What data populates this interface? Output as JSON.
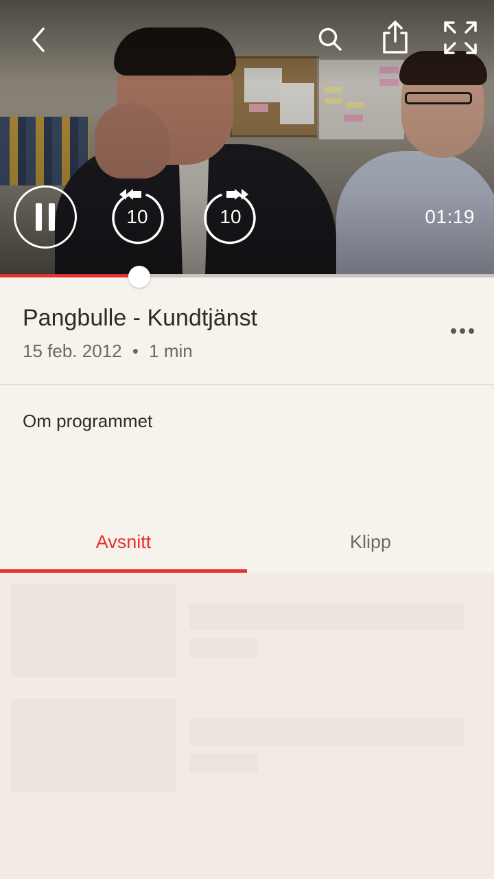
{
  "player": {
    "skip_back_seconds": "10",
    "skip_forward_seconds": "10",
    "time_display": "01:19",
    "progress_fraction": 0.26,
    "state": "playing",
    "icons": {
      "back": "chevron-left-icon",
      "search": "search-icon",
      "share": "share-icon",
      "fullscreen": "fullscreen-icon",
      "pause": "pause-icon",
      "rewind": "rewind-10-icon",
      "forward": "forward-10-icon"
    }
  },
  "program": {
    "title": "Pangbulle - Kundtjänst",
    "date": "15 feb. 2012",
    "separator": "•",
    "duration": "1 min",
    "about_label": "Om programmet"
  },
  "tabs": [
    {
      "label": "Avsnitt",
      "active": true
    },
    {
      "label": "Klipp",
      "active": false
    }
  ],
  "colors": {
    "accent": "#e8302e",
    "background": "#f6f2ec",
    "list_background": "#f3ebe3",
    "skeleton": "#ece4dd"
  }
}
